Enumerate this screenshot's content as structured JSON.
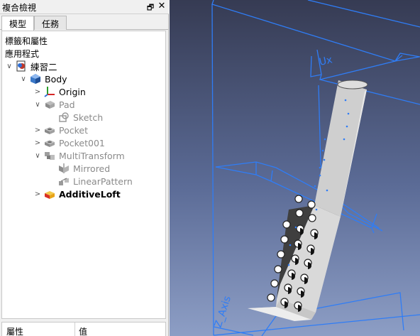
{
  "panel": {
    "title": "複合檢視",
    "float_icon": "float-icon",
    "close_icon": "close-icon",
    "tabs": [
      {
        "label": "模型",
        "active": true
      },
      {
        "label": "任務",
        "active": false
      }
    ]
  },
  "tree": {
    "section_labels": "標籤和屬性",
    "app_label": "應用程式",
    "items": [
      {
        "label": "練習二",
        "icon": "document-icon",
        "expander": "expanded",
        "style": "normal"
      },
      {
        "label": "Body",
        "icon": "body-icon",
        "expander": "expanded",
        "style": "normal"
      },
      {
        "label": "Origin",
        "icon": "origin-axes-icon",
        "expander": "collapsed",
        "style": "normal"
      },
      {
        "label": "Pad",
        "icon": "pad-icon",
        "expander": "expanded",
        "style": "hidden"
      },
      {
        "label": "Sketch",
        "icon": "sketch-icon",
        "expander": "none",
        "style": "hidden"
      },
      {
        "label": "Pocket",
        "icon": "pocket-icon",
        "expander": "collapsed",
        "style": "hidden"
      },
      {
        "label": "Pocket001",
        "icon": "pocket-icon",
        "expander": "collapsed",
        "style": "hidden"
      },
      {
        "label": "MultiTransform",
        "icon": "multitransform-icon",
        "expander": "expanded",
        "style": "hidden"
      },
      {
        "label": "Mirrored",
        "icon": "mirrored-icon",
        "expander": "none",
        "style": "hidden"
      },
      {
        "label": "LinearPattern",
        "icon": "linearpattern-icon",
        "expander": "none",
        "style": "hidden"
      },
      {
        "label": "AdditiveLoft",
        "icon": "additiveloft-icon",
        "expander": "collapsed",
        "style": "bold"
      }
    ]
  },
  "properties": {
    "col_property": "屬性",
    "col_value": "值"
  },
  "viewport": {
    "axis_label_top": "Ux",
    "axis_label_bottom": "Z_Axis",
    "colors": {
      "accent": "#2f7df6",
      "background_top": "#363b53",
      "background_bottom": "#8d9ec5",
      "solid_dark": "#4a4a4a",
      "solid_light": "#cfcfcf"
    }
  }
}
